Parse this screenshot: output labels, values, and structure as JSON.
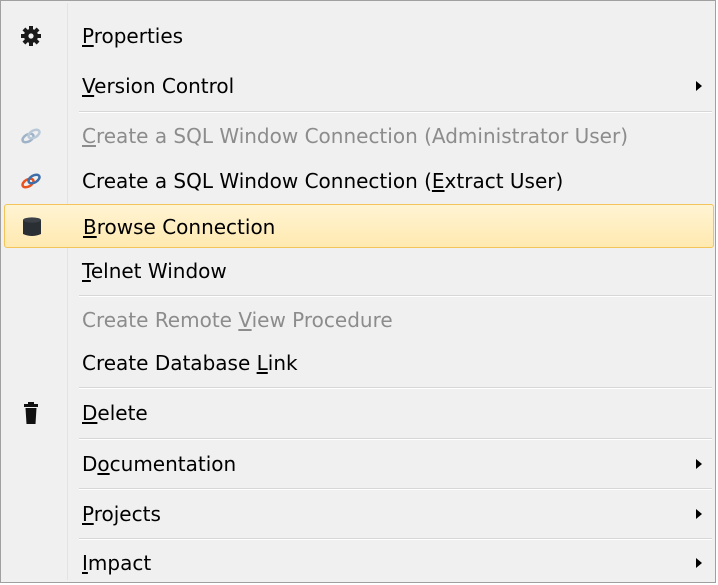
{
  "menu": {
    "items": [
      {
        "before": "",
        "accel": "P",
        "after": "roperties",
        "icon": "gear-icon",
        "disabled": false,
        "submenu": false
      },
      {
        "before": "",
        "accel": "V",
        "after": "ersion Control",
        "icon": "",
        "disabled": false,
        "submenu": true
      },
      {
        "before": "",
        "accel": "C",
        "after": "reate a SQL Window Connection (Administrator User)",
        "icon": "link-icon",
        "disabled": true,
        "submenu": false
      },
      {
        "before": "Create a SQL Window Connection (",
        "accel": "E",
        "after": "xtract User)",
        "icon": "link-icon",
        "disabled": false,
        "submenu": false
      },
      {
        "before": "",
        "accel": "B",
        "after": "rowse Connection",
        "icon": "database-icon",
        "disabled": false,
        "submenu": false
      },
      {
        "before": "",
        "accel": "T",
        "after": "elnet Window",
        "icon": "",
        "disabled": false,
        "submenu": false
      },
      {
        "before": "Create Remote ",
        "accel": "V",
        "after": "iew Procedure",
        "icon": "",
        "disabled": true,
        "submenu": false
      },
      {
        "before": "Create Database ",
        "accel": "L",
        "after": "ink",
        "icon": "",
        "disabled": false,
        "submenu": false
      },
      {
        "before": "",
        "accel": "D",
        "after": "elete",
        "icon": "trash-icon",
        "disabled": false,
        "submenu": false
      },
      {
        "before": "D",
        "accel": "o",
        "after": "cumentation",
        "icon": "",
        "disabled": false,
        "submenu": true
      },
      {
        "before": "",
        "accel": "P",
        "after": "rojects",
        "icon": "",
        "disabled": false,
        "submenu": true
      },
      {
        "before": "",
        "accel": "I",
        "after": "mpact",
        "icon": "",
        "disabled": false,
        "submenu": true
      }
    ],
    "highlighted_item": "Browse Connection"
  },
  "colors": {
    "menu_background": "#f0f0f0",
    "highlight_fill": "#ffe9b0",
    "highlight_border": "#f3c45a",
    "disabled_text": "#8c8c8c",
    "link_icon_active": "#e8531f",
    "link_icon_disabled": "#9fb3c8"
  }
}
